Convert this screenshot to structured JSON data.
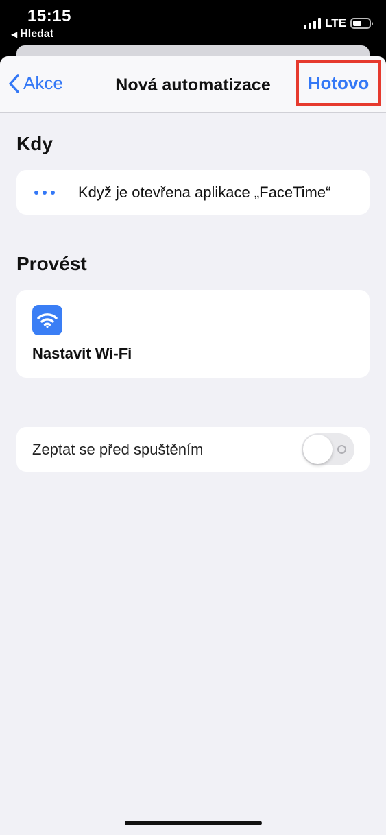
{
  "status_bar": {
    "time": "15:15",
    "back_app": "Hledat",
    "network": "LTE"
  },
  "nav": {
    "back_label": "Akce",
    "title": "Nová automatizace",
    "done_label": "Hotovo",
    "accent_color": "#3478f6",
    "highlight_color": "#e63a2e"
  },
  "when": {
    "title": "Kdy",
    "trigger_text": "Když je otevřena aplikace „FaceTime“",
    "icon": "more-dots-icon"
  },
  "do": {
    "title": "Provést",
    "action_label": "Nastavit Wi-Fi",
    "icon": "wifi-icon"
  },
  "ask_before_run": {
    "label": "Zeptat se před spuštěním",
    "enabled": false
  }
}
